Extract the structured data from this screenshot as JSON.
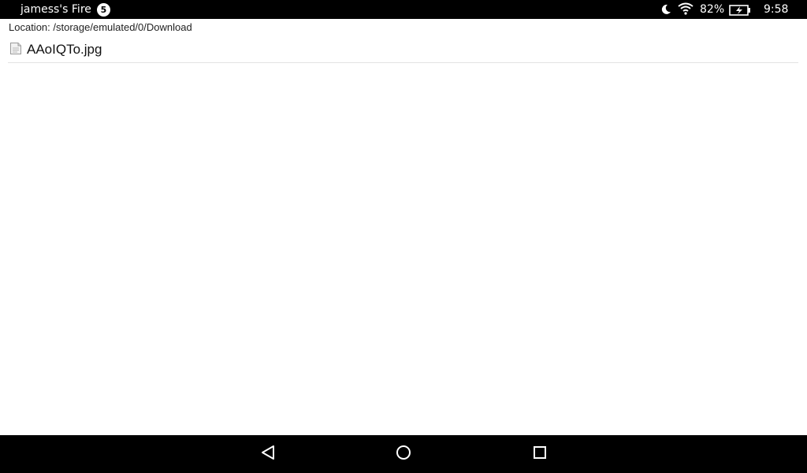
{
  "status_bar": {
    "device_name": "jamess's Fire",
    "notification_count": "5",
    "battery_percent": "82%",
    "time": "9:58",
    "icons": [
      "moon-icon",
      "wifi-icon",
      "battery-charging-icon"
    ]
  },
  "browser": {
    "location_label": "Location: /storage/emulated/0/Download",
    "files": [
      {
        "name": "AAoIQTo.jpg",
        "icon": "file-icon"
      }
    ]
  },
  "nav_bar": {
    "buttons": [
      "back-icon",
      "home-icon",
      "recent-apps-icon"
    ]
  },
  "colors": {
    "bars": "#000000",
    "background": "#ffffff",
    "divider": "#e3e3e3"
  }
}
